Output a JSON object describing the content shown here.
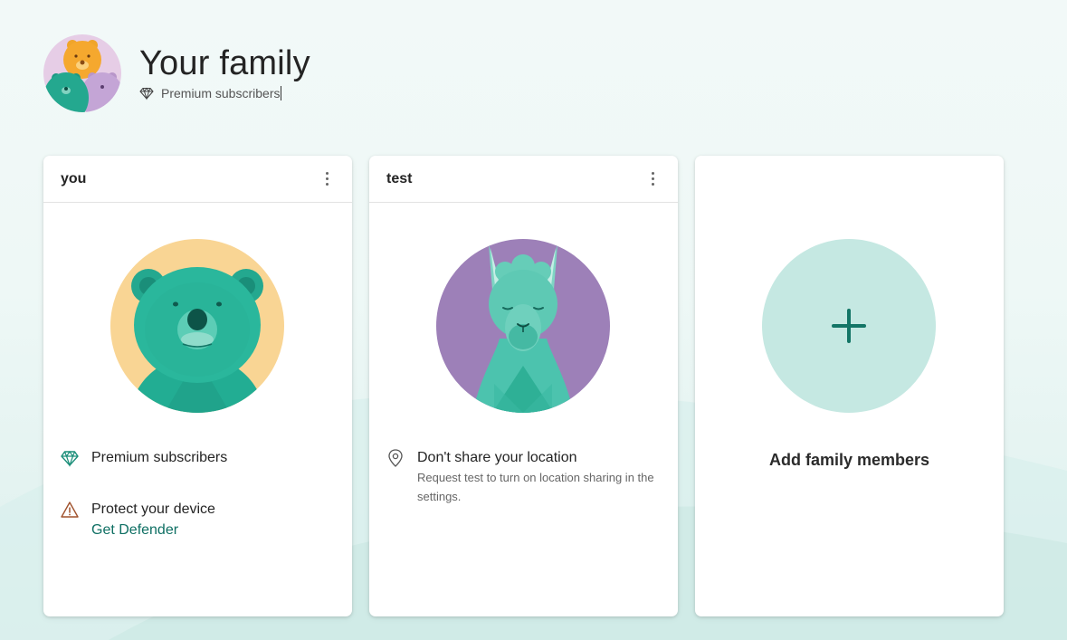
{
  "header": {
    "title": "Your family",
    "subtitle": "Premium subscribers"
  },
  "members": [
    {
      "name": "you",
      "avatar": "bear",
      "info": [
        {
          "icon": "diamond-icon",
          "text": "Premium subscribers"
        },
        {
          "icon": "warning-icon",
          "text": "Protect your device",
          "link": "Get Defender"
        }
      ]
    },
    {
      "name": "test",
      "avatar": "llama",
      "info": [
        {
          "icon": "location-pin-icon",
          "text": "Don't share your location",
          "sub": "Request test to turn on location sharing in the settings."
        }
      ]
    }
  ],
  "add_card": {
    "label": "Add family members",
    "icon": "plus-icon"
  },
  "colors": {
    "accent": "#0e6f63",
    "teal": "#2fb39a",
    "bear_bg": "#f9d594",
    "llama_bg": "#9d80b8",
    "add_circle": "#c5e8e2",
    "warning": "#a0522d"
  }
}
